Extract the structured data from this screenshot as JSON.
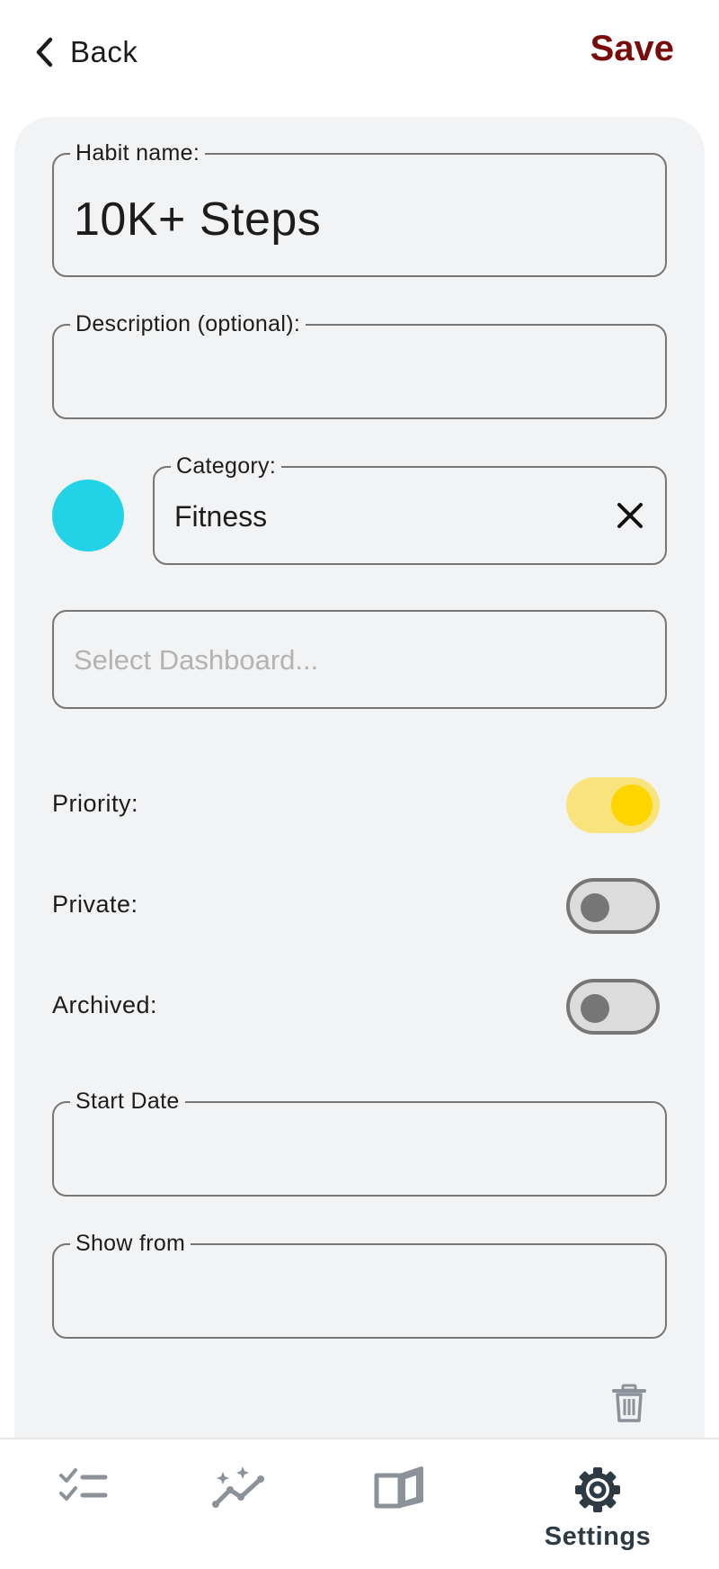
{
  "header": {
    "back_label": "Back",
    "save_label": "Save"
  },
  "form": {
    "habit_name": {
      "label": "Habit name:",
      "value": "10K+ Steps"
    },
    "description": {
      "label": "Description (optional):",
      "value": ""
    },
    "category": {
      "label": "Category:",
      "value": "Fitness",
      "color": "#22d3e8"
    },
    "dashboard": {
      "placeholder": "Select Dashboard..."
    },
    "toggles": [
      {
        "label": "Priority:",
        "on": true
      },
      {
        "label": "Private:",
        "on": false
      },
      {
        "label": "Archived:",
        "on": false
      }
    ],
    "start_date": {
      "label": "Start Date",
      "value": ""
    },
    "show_from": {
      "label": "Show from",
      "value": ""
    }
  },
  "bottom_nav": {
    "items": [
      {
        "icon": "tasks-checklist-icon",
        "label": ""
      },
      {
        "icon": "stats-sparkle-chart-icon",
        "label": ""
      },
      {
        "icon": "journal-book-icon",
        "label": ""
      },
      {
        "icon": "gear-icon",
        "label": "Settings",
        "active": true
      }
    ]
  },
  "colors": {
    "accent_save": "#7a0b0b",
    "card_background": "#f2f3f5",
    "toggle_on_track": "#f9e37c",
    "toggle_on_knob": "#ffd500",
    "toggle_off_track": "#dcdcdc",
    "icon_gray": "#8c9299",
    "active_nav": "#2e3a44"
  }
}
